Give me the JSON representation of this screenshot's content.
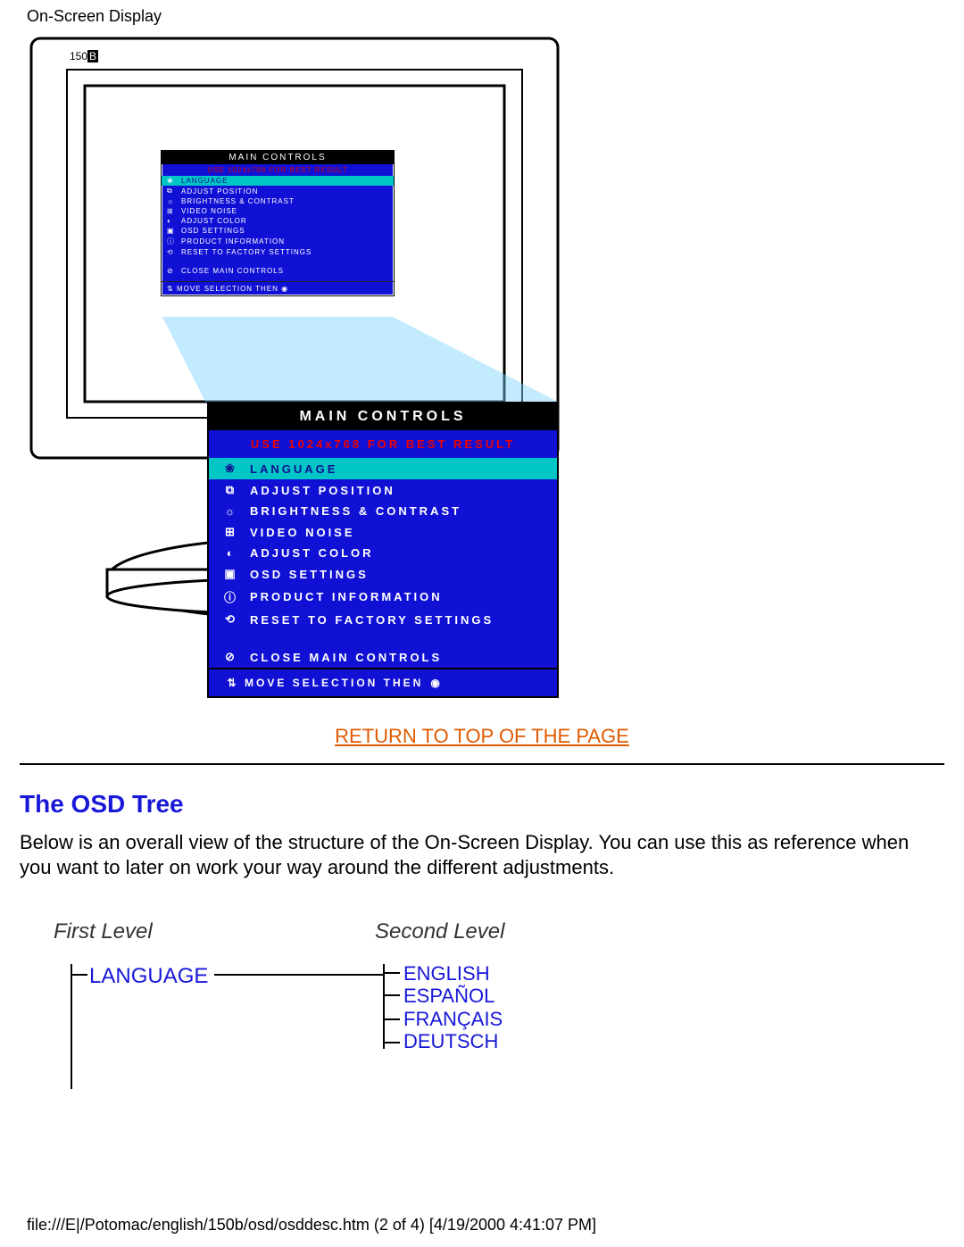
{
  "page": {
    "header": "On-Screen Display",
    "return_link": "RETURN TO TOP OF THE PAGE",
    "section_title": "The OSD Tree",
    "body_text": "Below is an overall view of the structure of the On-Screen Display. You can use this as reference when you want to later on work your way around the different adjustments.",
    "footer_path": "file:///E|/Potomac/english/150b/osd/osddesc.htm (2 of 4) [4/19/2000 4:41:07 PM]"
  },
  "monitor": {
    "model_prefix": "150",
    "model_suffix": "B"
  },
  "osd": {
    "title": "MAIN CONTROLS",
    "warning": "USE 1024x768 FOR BEST RESULT",
    "items": [
      {
        "icon": "language-icon",
        "label": "LANGUAGE",
        "selected": true
      },
      {
        "icon": "position-icon",
        "label": "ADJUST POSITION",
        "selected": false
      },
      {
        "icon": "brightness-icon",
        "label": "BRIGHTNESS & CONTRAST",
        "selected": false
      },
      {
        "icon": "noise-icon",
        "label": "VIDEO NOISE",
        "selected": false
      },
      {
        "icon": "color-icon",
        "label": "ADJUST COLOR",
        "selected": false
      },
      {
        "icon": "settings-icon",
        "label": "OSD SETTINGS",
        "selected": false
      },
      {
        "icon": "info-icon",
        "label": "PRODUCT INFORMATION",
        "selected": false
      },
      {
        "icon": "reset-icon",
        "label": "RESET TO FACTORY SETTINGS",
        "selected": false
      }
    ],
    "close_label": "CLOSE MAIN CONTROLS",
    "footer_label": "MOVE SELECTION THEN"
  },
  "tree": {
    "level1_label": "First Level",
    "level2_label": "Second Level",
    "root": "LANGUAGE",
    "children": [
      "ENGLISH",
      "ESPAÑOL",
      "FRANÇAIS",
      "DEUTSCH"
    ]
  }
}
